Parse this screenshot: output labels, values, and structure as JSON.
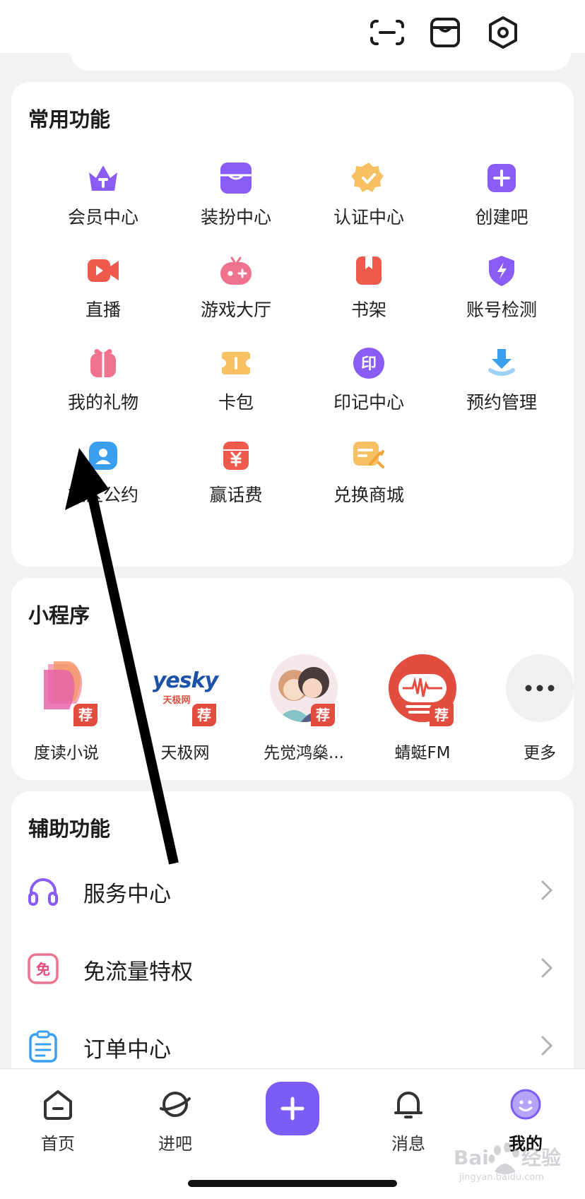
{
  "colors": {
    "accent": "#7b5cf5",
    "recommend": "#e34d3f",
    "background": "#f2f2f5"
  },
  "top_icons": [
    "scan-icon",
    "store-box-icon",
    "settings-hexagon-icon"
  ],
  "common": {
    "title": "常用功能",
    "items": [
      {
        "label": "会员中心",
        "icon": "crown-icon"
      },
      {
        "label": "装扮中心",
        "icon": "wardrobe-icon"
      },
      {
        "label": "认证中心",
        "icon": "verified-badge-icon"
      },
      {
        "label": "创建吧",
        "icon": "plus-square-icon"
      },
      {
        "label": "直播",
        "icon": "video-camera-icon"
      },
      {
        "label": "游戏大厅",
        "icon": "gamepad-icon"
      },
      {
        "label": "书架",
        "icon": "bookmark-book-icon"
      },
      {
        "label": "账号检测",
        "icon": "shield-bolt-icon"
      },
      {
        "label": "我的礼物",
        "icon": "gift-icon"
      },
      {
        "label": "卡包",
        "icon": "ticket-icon"
      },
      {
        "label": "印记中心",
        "icon": "seal-icon"
      },
      {
        "label": "预约管理",
        "icon": "download-calendar-icon"
      },
      {
        "label": "社区公约",
        "icon": "community-icon"
      },
      {
        "label": "赢话费",
        "icon": "coin-bag-icon"
      },
      {
        "label": "兑换商城",
        "icon": "exchange-shop-icon"
      }
    ]
  },
  "mini": {
    "title": "小程序",
    "recommend_badge": "荐",
    "items": [
      {
        "label": "度读小说",
        "logo": "book-logo"
      },
      {
        "label": "天极网",
        "logo": "yesky-logo",
        "logo_text": "yesky",
        "logo_sub": "天极网"
      },
      {
        "label": "先觉鸿燊...",
        "logo": "couple-avatar-logo"
      },
      {
        "label": "蜻蜓FM",
        "logo": "radio-logo"
      },
      {
        "label": "更多",
        "logo": "more-dots-icon"
      }
    ]
  },
  "assist": {
    "title": "辅助功能",
    "items": [
      {
        "label": "服务中心",
        "icon": "headphones-icon"
      },
      {
        "label": "免流量特权",
        "icon": "free-data-icon",
        "icon_text": "免"
      },
      {
        "label": "订单中心",
        "icon": "clipboard-icon"
      }
    ]
  },
  "tabbar": {
    "home": "首页",
    "enter": "进吧",
    "messages": "消息",
    "mine": "我的"
  },
  "watermark": {
    "text": "Baidu经验",
    "sub": "jingyan.baidu.com"
  }
}
